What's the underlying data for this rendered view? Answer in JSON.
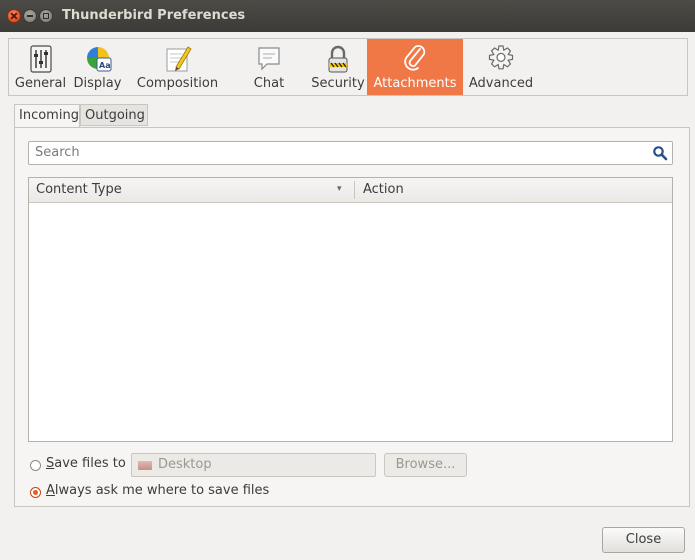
{
  "window": {
    "title": "Thunderbird Preferences"
  },
  "toolbar": {
    "items": [
      {
        "label": "General",
        "icon": "sliders-icon"
      },
      {
        "label": "Display",
        "icon": "palette-icon"
      },
      {
        "label": "Composition",
        "icon": "pencil-paper-icon"
      },
      {
        "label": "Chat",
        "icon": "chat-bubble-icon"
      },
      {
        "label": "Security",
        "icon": "padlock-icon"
      },
      {
        "label": "Attachments",
        "icon": "paperclip-icon",
        "active": true
      },
      {
        "label": "Advanced",
        "icon": "gear-icon"
      }
    ]
  },
  "tabs": [
    {
      "label": "Incoming",
      "selected": true
    },
    {
      "label": "Outgoing",
      "selected": false
    }
  ],
  "search": {
    "placeholder": "Search"
  },
  "table": {
    "columns": [
      "Content Type",
      "Action"
    ],
    "sort_indicator": "▾",
    "rows": []
  },
  "save": {
    "save_files_to_label": "Save files to",
    "directory": "Desktop",
    "browse_label": "Browse...",
    "always_ask_label": "Always ask me where to save files",
    "selected_option": "always_ask"
  },
  "footer": {
    "close_label": "Close"
  },
  "colors": {
    "accent": "#f07746",
    "titlebar": "#3c3b37",
    "window_bg": "#f2f1f0"
  }
}
